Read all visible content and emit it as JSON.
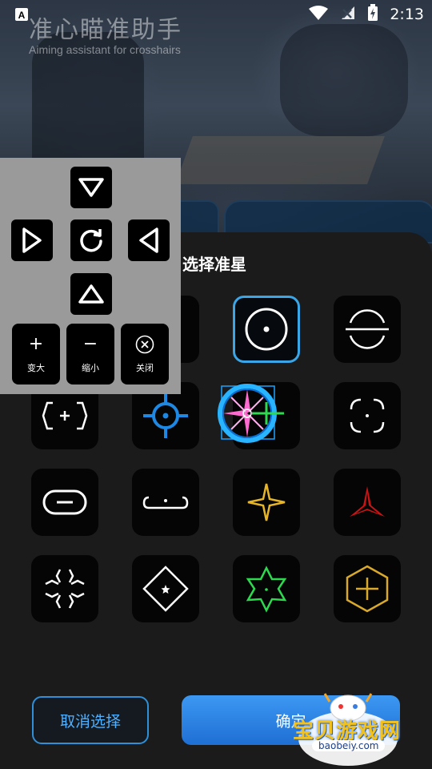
{
  "status_bar": {
    "time": "2:13",
    "icons": [
      "app-a-icon",
      "wifi-icon",
      "no-signal-icon",
      "battery-charging-icon"
    ]
  },
  "header": {
    "title": "准心瞄准助手",
    "subtitle": "Aiming assistant for crosshairs"
  },
  "section_title": "选择准星",
  "controls": {
    "zoom_in_label": "变大",
    "zoom_out_label": "缩小",
    "close_label": "关闭",
    "zoom_in_glyph": "+",
    "zoom_out_glyph": "−",
    "move_up": "triangle-down-icon",
    "move_right": "play-right-icon",
    "reset": "refresh-icon",
    "move_left": "play-left-icon",
    "move_down": "triangle-up-icon"
  },
  "crosshairs": [
    {
      "name": "crosshair-hidden-1",
      "color": "#ffffff"
    },
    {
      "name": "crosshair-circle-dot",
      "color": "#ffffff",
      "selected": true
    },
    {
      "name": "crosshair-split-circle",
      "color": "#ffffff"
    },
    {
      "name": "crosshair-hex-plus",
      "color": "#ffffff",
      "text": "+"
    },
    {
      "name": "crosshair-blue-scope",
      "color": "#1e88e5"
    },
    {
      "name": "crosshair-neon-scope",
      "color": "#ff5ec4"
    },
    {
      "name": "crosshair-corner-box",
      "color": "#ffffff"
    },
    {
      "name": "crosshair-pill-minus",
      "color": "#ffffff"
    },
    {
      "name": "crosshair-bracket-dot",
      "color": "#ffffff"
    },
    {
      "name": "crosshair-gold-star",
      "color": "#e6b52a"
    },
    {
      "name": "crosshair-red-tri",
      "color": "#d01818"
    },
    {
      "name": "crosshair-burst",
      "color": "#ffffff"
    },
    {
      "name": "crosshair-diamond-star",
      "color": "#ffffff"
    },
    {
      "name": "crosshair-green-hexagram",
      "color": "#33dd44"
    },
    {
      "name": "crosshair-gold-hex-plus",
      "color": "#d8a92a"
    }
  ],
  "buttons": {
    "cancel": "取消选择",
    "confirm": "确定"
  },
  "watermark": {
    "text": "宝贝游戏网",
    "url": "baobeiy.com"
  },
  "colors": {
    "accent": "#3aa6e8",
    "confirm_bg": "#2a82e4",
    "panel_bg": "#1b1b1c",
    "control_overlay": "#9a9a9a"
  }
}
